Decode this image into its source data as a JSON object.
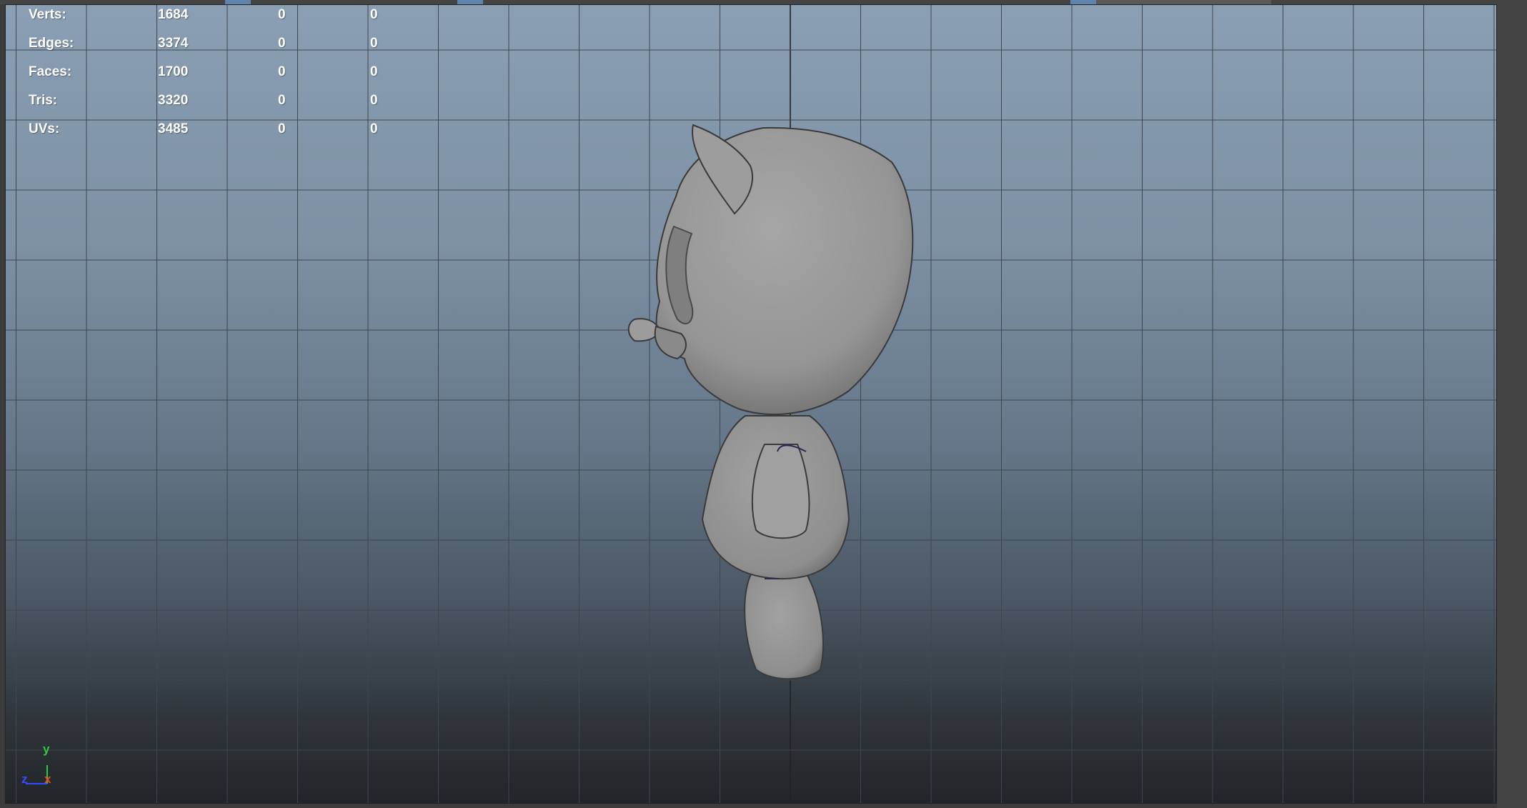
{
  "hud": {
    "rows": [
      {
        "label": "Verts:",
        "v1": "1684",
        "v2": "0",
        "v3": "0"
      },
      {
        "label": "Edges:",
        "v1": "3374",
        "v2": "0",
        "v3": "0"
      },
      {
        "label": "Faces:",
        "v1": "1700",
        "v2": "0",
        "v3": "0"
      },
      {
        "label": "Tris:",
        "v1": "3320",
        "v2": "0",
        "v3": "0"
      },
      {
        "label": "UVs:",
        "v1": "3485",
        "v2": "0",
        "v3": "0"
      }
    ]
  },
  "axis": {
    "y_label": "y",
    "z_label": "z",
    "x_label": "x"
  },
  "colors": {
    "viewport_top": "#8a9fb4",
    "viewport_bottom": "#22262a",
    "grid_line": "#3e4650",
    "model_fill": "#9a9a9a",
    "axis_y": "#2ecc40",
    "axis_z": "#3050ff",
    "axis_x": "#e84a1c",
    "highlight_blue": "#5f85ad"
  }
}
